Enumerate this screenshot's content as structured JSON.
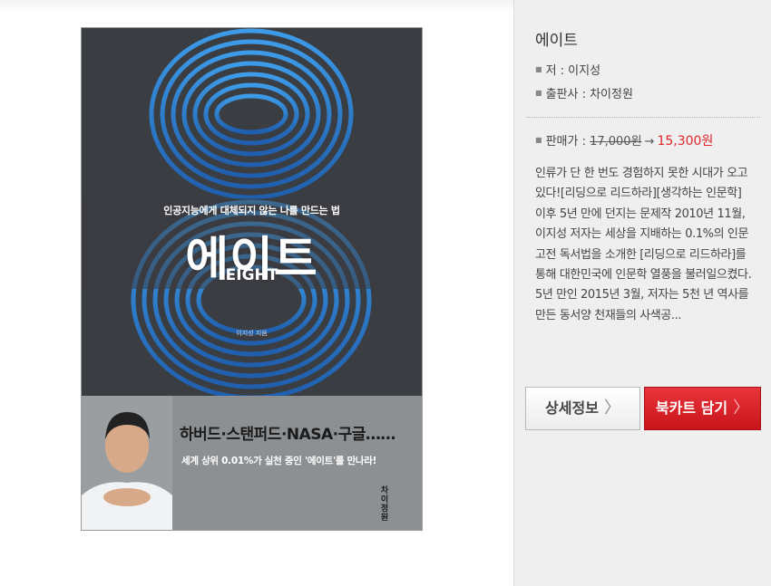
{
  "cover": {
    "subtitle": "인공지능에게 대체되지 않는 나를 만드는 법",
    "title": "에이트",
    "title_en": "EIGHT",
    "author_small": "이지성 지음",
    "tagline": "하버드·스탠퍼드·NASA·구글……",
    "tagline2": "세계 상위 0.01%가 실천 중인 '에이트'를 만나라!",
    "publisher_mark": "차이정원"
  },
  "book": {
    "title": "에이트",
    "author": "저 : 이지성",
    "publisher": "출판사 : 차이정원",
    "price_label": "판매가 : ",
    "original_price": "17,000원",
    "arrow": "→",
    "sale_price": "15,300원",
    "description": "인류가 단 한 번도 경험하지 못한 시대가 오고 있다![리딩으로 리드하라][생각하는 인문학] 이후 5년 만에 던지는 문제작 2010년 11월, 이지성 저자는 세상을 지배하는 0.1%의 인문고전 독서법을 소개한 [리딩으로 리드하라]를 통해 대한민국에 인문학 열풍을 불러일으켰다.5년 만인 2015년 3월, 저자는 5천 년 역사를 만든 동서양 천재들의 사색공..."
  },
  "buttons": {
    "detail": "상세정보",
    "cart": "북카트 담기",
    "chevron": "〉"
  },
  "colors": {
    "accent_red": "#e3262c",
    "cover_dark": "#3a3d42",
    "ring_blue": "#2a7fd0"
  }
}
